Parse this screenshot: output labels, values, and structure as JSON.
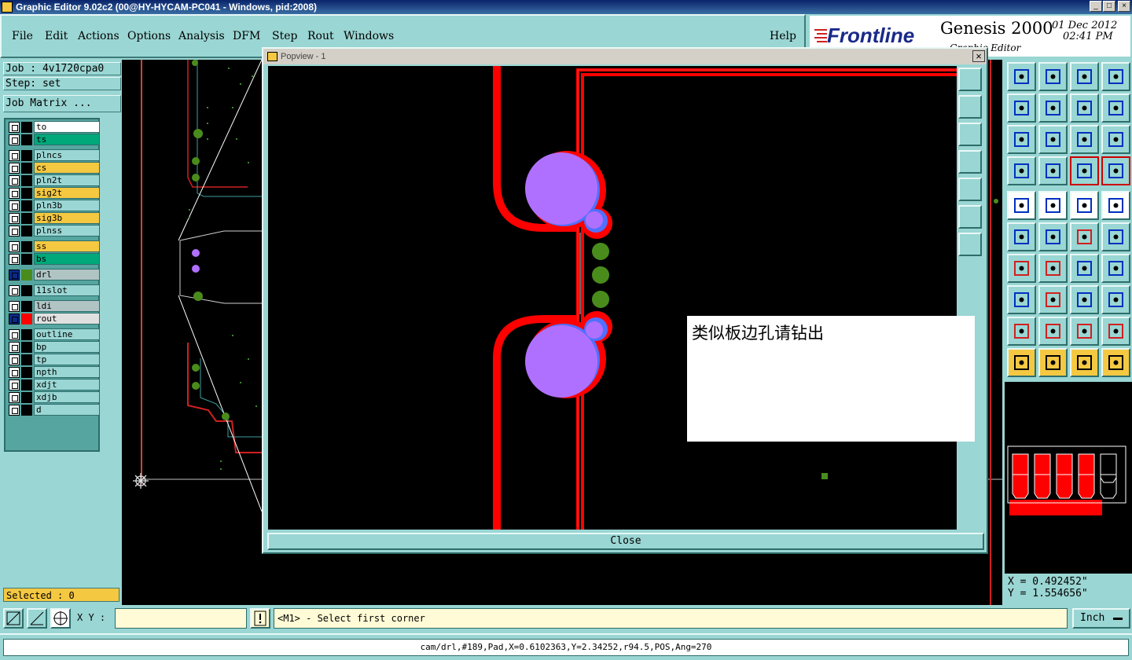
{
  "window": {
    "title": "Graphic Editor 9.02c2 (00@HY-HYCAM-PC041 - Windows, pid:2008)",
    "min": "_",
    "max": "□",
    "close": "×"
  },
  "menu": [
    "File",
    "Edit",
    "Actions",
    "Options",
    "Analysis",
    "DFM",
    "Step",
    "Rout",
    "Windows"
  ],
  "help": "Help",
  "brand": {
    "logo": "Frontline",
    "product": "Genesis 2000",
    "date": "01 Dec 2012",
    "time": "02:41 PM",
    "subtitle": "Graphic Editor"
  },
  "job": {
    "job_label": "Job : 4v1720cpa0",
    "step_label": "Step: set",
    "matrix_button": "Job Matrix ..."
  },
  "layers": [
    {
      "name": "to",
      "color": "#ffffff"
    },
    {
      "name": "ts",
      "color": "#00a87a"
    },
    {
      "name": "plncs",
      "color": "#9ad6d3"
    },
    {
      "name": "cs",
      "color": "#f5c842"
    },
    {
      "name": "pln2t",
      "color": "#9ad6d3"
    },
    {
      "name": "sig2t",
      "color": "#f5c842"
    },
    {
      "name": "pln3b",
      "color": "#9ad6d3"
    },
    {
      "name": "sig3b",
      "color": "#f5c842"
    },
    {
      "name": "plnss",
      "color": "#9ad6d3"
    },
    {
      "name": "ss",
      "color": "#f5c842"
    },
    {
      "name": "bs",
      "color": "#00a87a"
    },
    {
      "name": "drl",
      "color": "#b0c4c4",
      "active": true
    },
    {
      "name": "11slot",
      "color": "#9ad6d3"
    },
    {
      "name": "ldi",
      "color": "#b0c4c4"
    },
    {
      "name": "rout",
      "color": "#e0e0e0",
      "active": true
    },
    {
      "name": "outline",
      "color": "#9ad6d3"
    },
    {
      "name": "bp",
      "color": "#9ad6d3"
    },
    {
      "name": "tp",
      "color": "#9ad6d3"
    },
    {
      "name": "npth",
      "color": "#9ad6d3"
    },
    {
      "name": "xdjt",
      "color": "#9ad6d3"
    },
    {
      "name": "xdjb",
      "color": "#9ad6d3"
    },
    {
      "name": "d",
      "color": "#9ad6d3"
    }
  ],
  "selected": "Selected : 0",
  "popview": {
    "title": "Popview - 1",
    "close_label": "Close",
    "note": "类似板边孔请钻出"
  },
  "coords": {
    "x": "X = 0.492452\"",
    "y": "Y = 1.554656\""
  },
  "cmd": {
    "xy_label": "X Y :",
    "xy_value": "",
    "message": "<M1> - Select first corner",
    "units": "Inch"
  },
  "status": "cam/drl,#189,Pad,X=0.6102363,Y=2.34252,r94.5,POS,Ang=270",
  "colors": {
    "panel": "#9ad6d3",
    "rout": "#ff0000",
    "pad": "#b070ff",
    "drill": "#4a8c1c"
  }
}
